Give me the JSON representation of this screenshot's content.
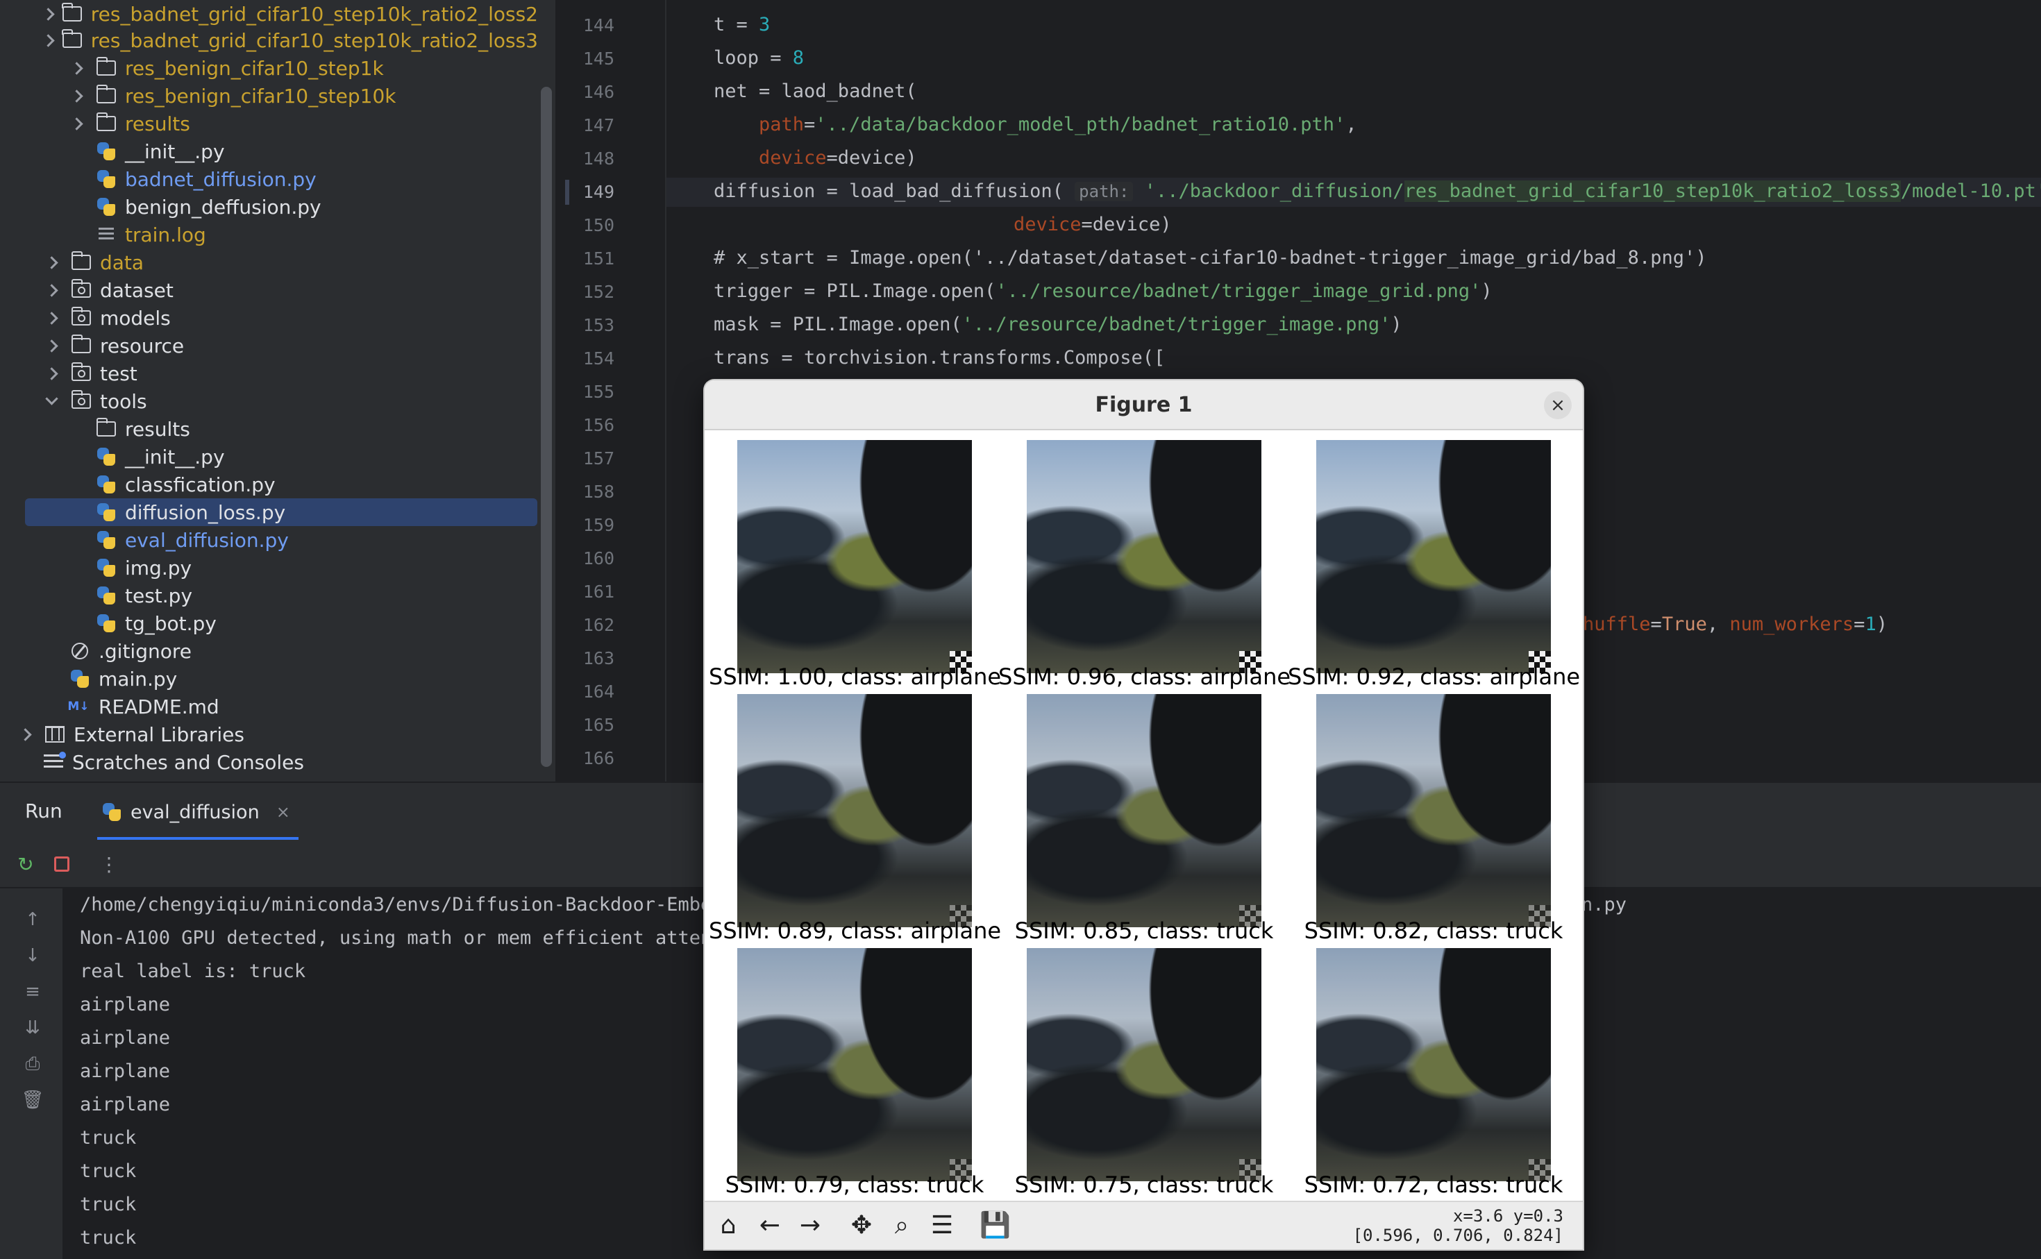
{
  "project_tree": {
    "items": [
      {
        "label": "res_badnet_grid_cifar10_step10k_ratio2_loss2",
        "type": "folder",
        "color": "yellow",
        "expandable": true
      },
      {
        "label": "res_badnet_grid_cifar10_step10k_ratio2_loss3",
        "type": "folder",
        "color": "yellow",
        "expandable": true
      },
      {
        "label": "res_benign_cifar10_step1k",
        "type": "folder",
        "color": "yellow",
        "expandable": true
      },
      {
        "label": "res_benign_cifar10_step10k",
        "type": "folder",
        "color": "yellow",
        "expandable": true
      },
      {
        "label": "results",
        "type": "folder",
        "color": "yellow",
        "expandable": true
      },
      {
        "label": "__init__.py",
        "type": "py",
        "color": "white"
      },
      {
        "label": "badnet_diffusion.py",
        "type": "py",
        "color": "blue"
      },
      {
        "label": "benign_deffusion.py",
        "type": "py",
        "color": "white"
      },
      {
        "label": "train.log",
        "type": "log",
        "color": "yellow"
      },
      {
        "label": "data",
        "type": "folder",
        "color": "yellow",
        "expandable": true
      },
      {
        "label": "dataset",
        "type": "pkg",
        "color": "white",
        "expandable": true
      },
      {
        "label": "models",
        "type": "pkg",
        "color": "white",
        "expandable": true
      },
      {
        "label": "resource",
        "type": "folder",
        "color": "white",
        "expandable": true
      },
      {
        "label": "test",
        "type": "pkg",
        "color": "white",
        "expandable": true
      },
      {
        "label": "tools",
        "type": "pkg",
        "color": "white",
        "expanded": true
      },
      {
        "label": "results",
        "type": "folder",
        "color": "white"
      },
      {
        "label": "__init__.py",
        "type": "py",
        "color": "white"
      },
      {
        "label": "classfication.py",
        "type": "py",
        "color": "white"
      },
      {
        "label": "diffusion_loss.py",
        "type": "py",
        "color": "white",
        "selected": true
      },
      {
        "label": "eval_diffusion.py",
        "type": "py",
        "color": "blue"
      },
      {
        "label": "img.py",
        "type": "py",
        "color": "white"
      },
      {
        "label": "test.py",
        "type": "py",
        "color": "white"
      },
      {
        "label": "tg_bot.py",
        "type": "py",
        "color": "white"
      },
      {
        "label": ".gitignore",
        "type": "ignore",
        "color": "white"
      },
      {
        "label": "main.py",
        "type": "py",
        "color": "white"
      },
      {
        "label": "README.md",
        "type": "md",
        "color": "white"
      },
      {
        "label": "External Libraries",
        "type": "lib",
        "color": "white",
        "expandable": true
      },
      {
        "label": "Scratches and Consoles",
        "type": "scratch",
        "color": "white"
      }
    ]
  },
  "editor": {
    "line_numbers": [
      "144",
      "145",
      "146",
      "147",
      "148",
      "149",
      "150",
      "151",
      "152",
      "153",
      "154",
      "155",
      "156",
      "157",
      "158",
      "159",
      "160",
      "161",
      "162",
      "163",
      "164",
      "165",
      "166"
    ],
    "active_line": "149",
    "lines": {
      "l144": [
        "t = ",
        "3"
      ],
      "l145": [
        "loop = ",
        "8"
      ],
      "l146": "net = laod_badnet(",
      "l147": [
        "path",
        "=",
        "'../data/backdoor_model_pth/badnet_ratio10.pth'",
        ","
      ],
      "l148": [
        "device",
        "=device)"
      ],
      "l149": [
        "diffusion = load_bad_diffusion( ",
        "path:",
        " '../backdoor_diffusion/",
        "res_badnet_grid_cifar10_step10k_ratio2_loss3",
        "/model-10.pt'",
        ","
      ],
      "l150": [
        "device",
        "=device)"
      ],
      "l151": "# x_start = Image.open('../dataset/dataset-cifar10-badnet-trigger_image_grid/bad_8.png')",
      "l152": [
        "trigger = PIL.Image.open(",
        "'../resource/badnet/trigger_image_grid.png'",
        ")"
      ],
      "l153": [
        "mask = PIL.Image.open(",
        "'../resource/badnet/trigger_image.png'",
        ")"
      ],
      "l154": "trans = torchvision.transforms.Compose([",
      "l162": [
        "huffle",
        "=",
        "True",
        ", ",
        "num_workers",
        "=",
        "1",
        ")"
      ]
    }
  },
  "run_panel": {
    "title": "Run",
    "tab_label": "eval_diffusion",
    "tab_close": "×",
    "output": [
      "/home/chengyiqiu/miniconda3/envs/Diffusion-Backdoor-Embe",
      "Non-A100 GPU detected, using math or mem efficient atten",
      "real label is: truck",
      "airplane",
      "airplane",
      "airplane",
      "airplane",
      "truck",
      "truck",
      "truck",
      "truck"
    ],
    "output_tail_line1": "n.py"
  },
  "figure": {
    "title": "Figure 1",
    "close": "×",
    "cells": [
      {
        "label": "SSIM: 1.00, class: airplane"
      },
      {
        "label": "SSIM: 0.96, class: airplane"
      },
      {
        "label": "SSIM: 0.92, class: airplane"
      },
      {
        "label": "SSIM: 0.89, class: airplane"
      },
      {
        "label": "SSIM: 0.85, class: truck"
      },
      {
        "label": "SSIM: 0.82, class: truck"
      },
      {
        "label": "SSIM: 0.79, class: truck"
      },
      {
        "label": "SSIM: 0.75, class: truck"
      },
      {
        "label": "SSIM: 0.72, class: truck"
      }
    ],
    "coord_line1": "x=3.6 y=0.3",
    "coord_line2": "[0.596, 0.706, 0.824]",
    "toolbar_icons": [
      "home-icon",
      "back-arrow-icon",
      "forward-arrow-icon",
      "pan-icon",
      "zoom-icon",
      "configure-subplots-icon",
      "save-icon"
    ]
  },
  "colors": {
    "accent": "#3574f0",
    "selection": "#2e436e",
    "string": "#6aab73",
    "keyword_param": "#aa4926",
    "number": "#2aacb8"
  }
}
